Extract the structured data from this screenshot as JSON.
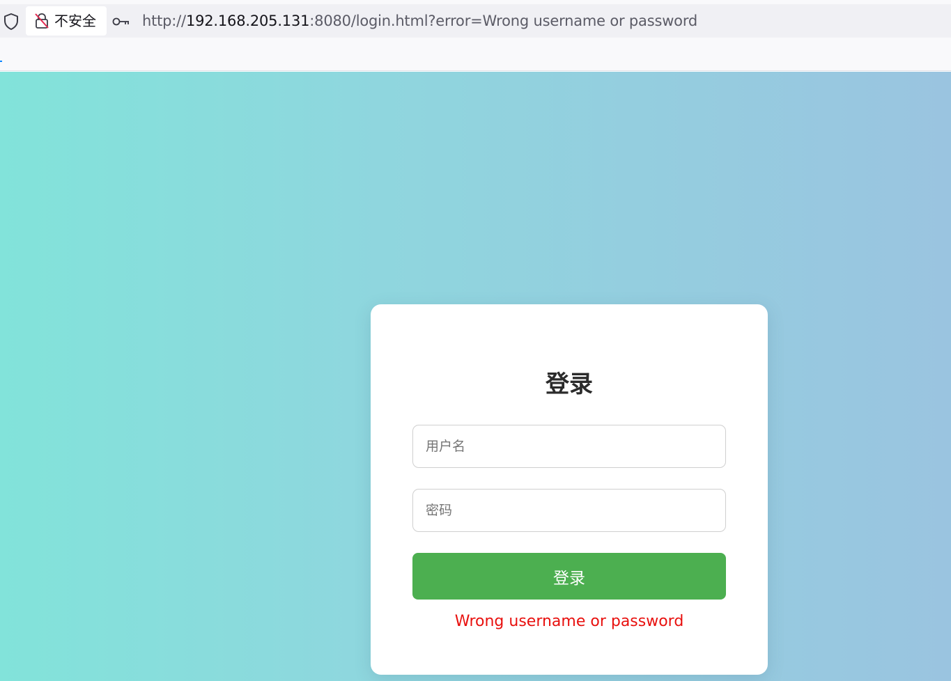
{
  "browser": {
    "security_label": "不安全",
    "url": {
      "scheme": "http://",
      "host": "192.168.205.131",
      "rest": ":8080/login.html?error=Wrong username or password"
    },
    "icons": {
      "shield": "shield-icon",
      "lock": "insecure-lock-icon",
      "key": "key-icon"
    }
  },
  "login": {
    "title": "登录",
    "username_placeholder": "用户名",
    "username_value": "",
    "password_placeholder": "密码",
    "password_value": "",
    "submit_label": "登录",
    "error_message": "Wrong username or password"
  },
  "colors": {
    "gradient_start": "#82e3da",
    "gradient_end": "#9ac4e0",
    "button": "#4caf50",
    "error": "#e8100e"
  }
}
